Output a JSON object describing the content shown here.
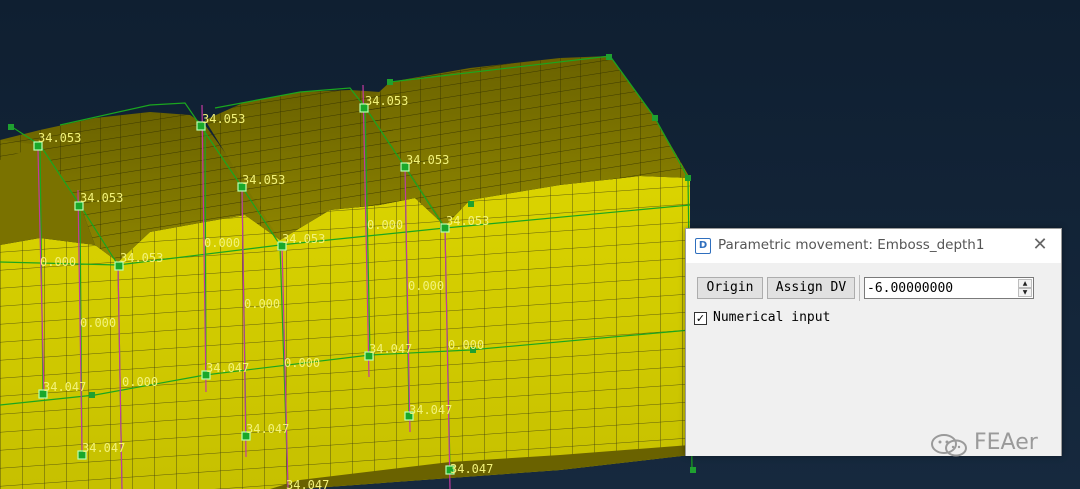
{
  "viewport": {
    "labels": [
      "34.053",
      "34.053",
      "34.053",
      "34.053",
      "34.053",
      "34.053",
      "34.053",
      "34.053",
      "0.000",
      "0.000",
      "0.000",
      "0.000",
      "0.000",
      "0.000",
      "0.000",
      "0.000",
      "0.000",
      "0.000",
      "34.047",
      "34.047",
      "34.047",
      "34.047",
      "34.047",
      "34.047",
      "34.047",
      "34.047"
    ]
  },
  "dialog": {
    "title": "Parametric movement: Emboss_depth1",
    "close_icon": "close-icon",
    "origin_label": "Origin",
    "assign_label": "Assign DV",
    "value": "-6.00000000",
    "numerical_checked": true,
    "numerical_label": "Numerical input"
  },
  "watermark": {
    "text": "FEAer"
  },
  "colors": {
    "background": "#112235",
    "surface": "#d4d000",
    "mesh_edge": "#1aa61f",
    "node": "#19a82a"
  }
}
